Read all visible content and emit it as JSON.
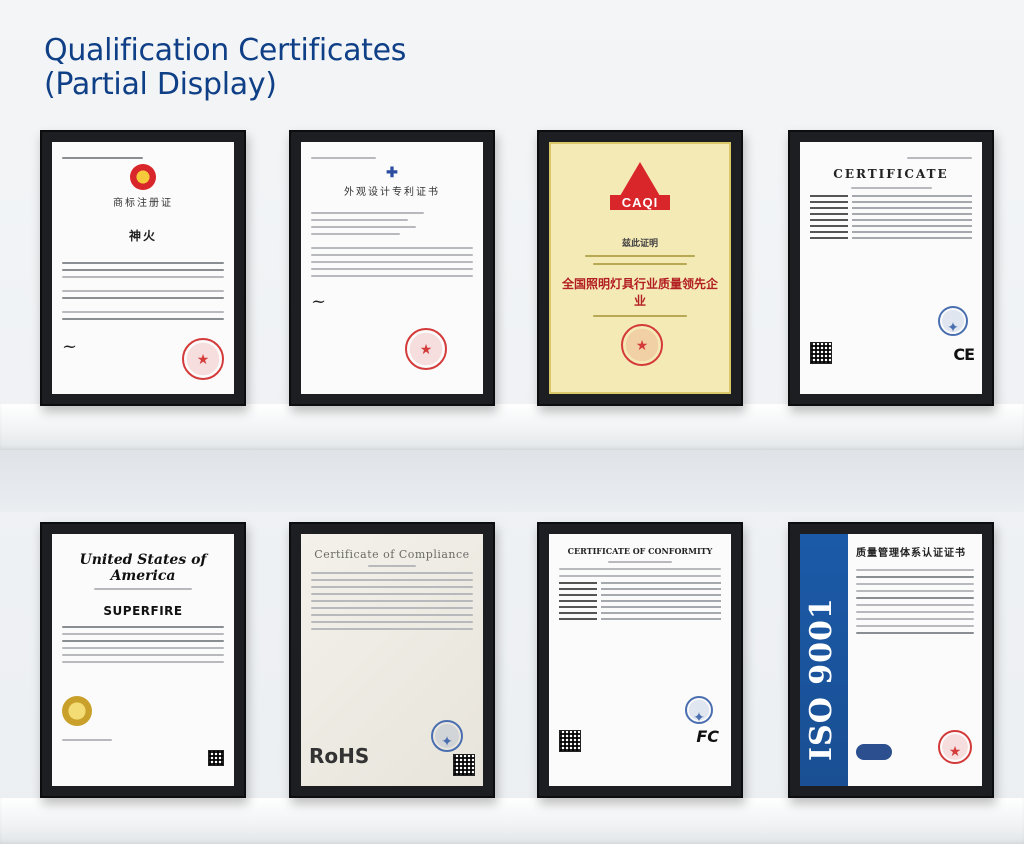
{
  "page": {
    "title_line1": "Qualification Certificates",
    "title_line2": "(Partial Display)"
  },
  "certificates": [
    {
      "id": "trademark",
      "heading_cn": "商标注册证",
      "mark": "神火"
    },
    {
      "id": "design_patent",
      "heading_cn": "外观设计专利证书"
    },
    {
      "id": "caqi",
      "logo_text": "CAQI",
      "heading_cn": "兹此证明",
      "line_cn": "全国照明灯具行业质量领先企业"
    },
    {
      "id": "ce",
      "heading": "CERTIFICATE",
      "mark": "CE"
    },
    {
      "id": "us_trademark",
      "heading": "United States of America",
      "mark": "SUPERFIRE"
    },
    {
      "id": "rohs",
      "heading": "Certificate of Compliance",
      "mark": "RoHS"
    },
    {
      "id": "fcc",
      "heading": "CERTIFICATE OF CONFORMITY",
      "mark": "FC"
    },
    {
      "id": "iso9001",
      "band_text": "ISO 9001",
      "heading_cn": "质量管理体系认证证书"
    }
  ]
}
